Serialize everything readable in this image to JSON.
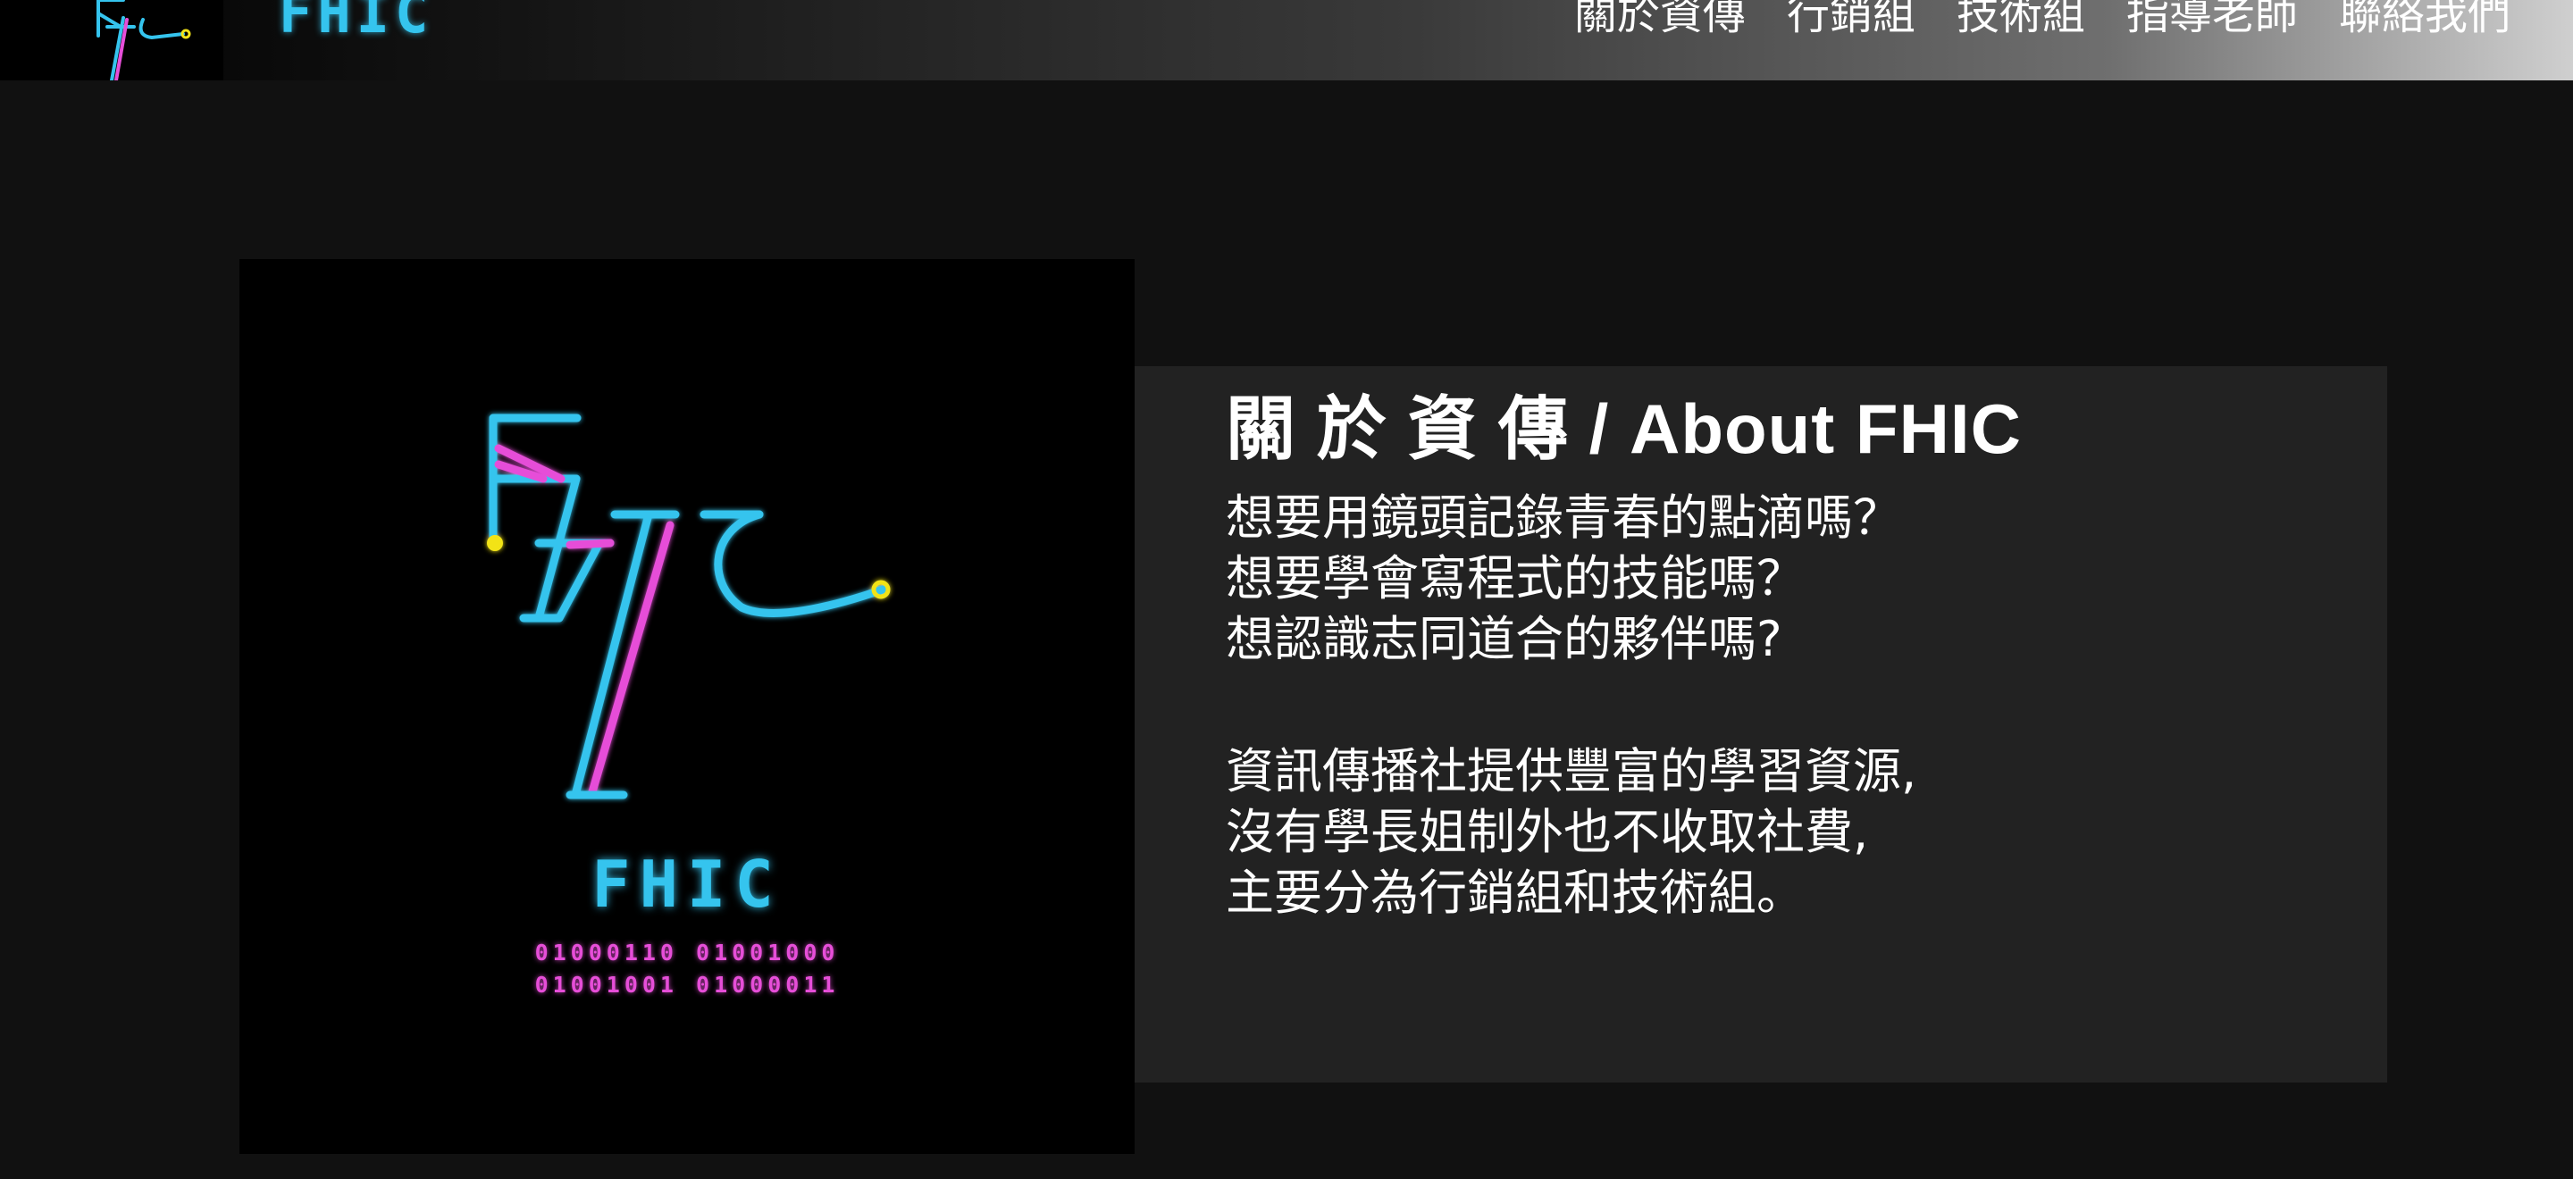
{
  "navbar": {
    "brand": "FHIC",
    "links": [
      "關於資傳",
      "行銷組",
      "技術組",
      "指導老師",
      "聯絡我們"
    ]
  },
  "logo": {
    "text": "FHIC",
    "binary": [
      "01000110 01001000",
      "01001001 01000011"
    ],
    "colors": {
      "cyan": "#35c4ee",
      "magenta": "#e64ed8",
      "yellow": "#f2e318"
    }
  },
  "about": {
    "title": "關 於 資 傳 / About FHIC",
    "paragraph1": [
      "想要用鏡頭記錄青春的點滴嗎？",
      "想要學會寫程式的技能嗎？",
      "想認識志同道合的夥伴嗎?"
    ],
    "paragraph2": [
      "資訊傳播社提供豐富的學習資源,",
      "沒有學長姐制外也不收取社費,",
      "主要分為行銷組和技術組。"
    ]
  }
}
